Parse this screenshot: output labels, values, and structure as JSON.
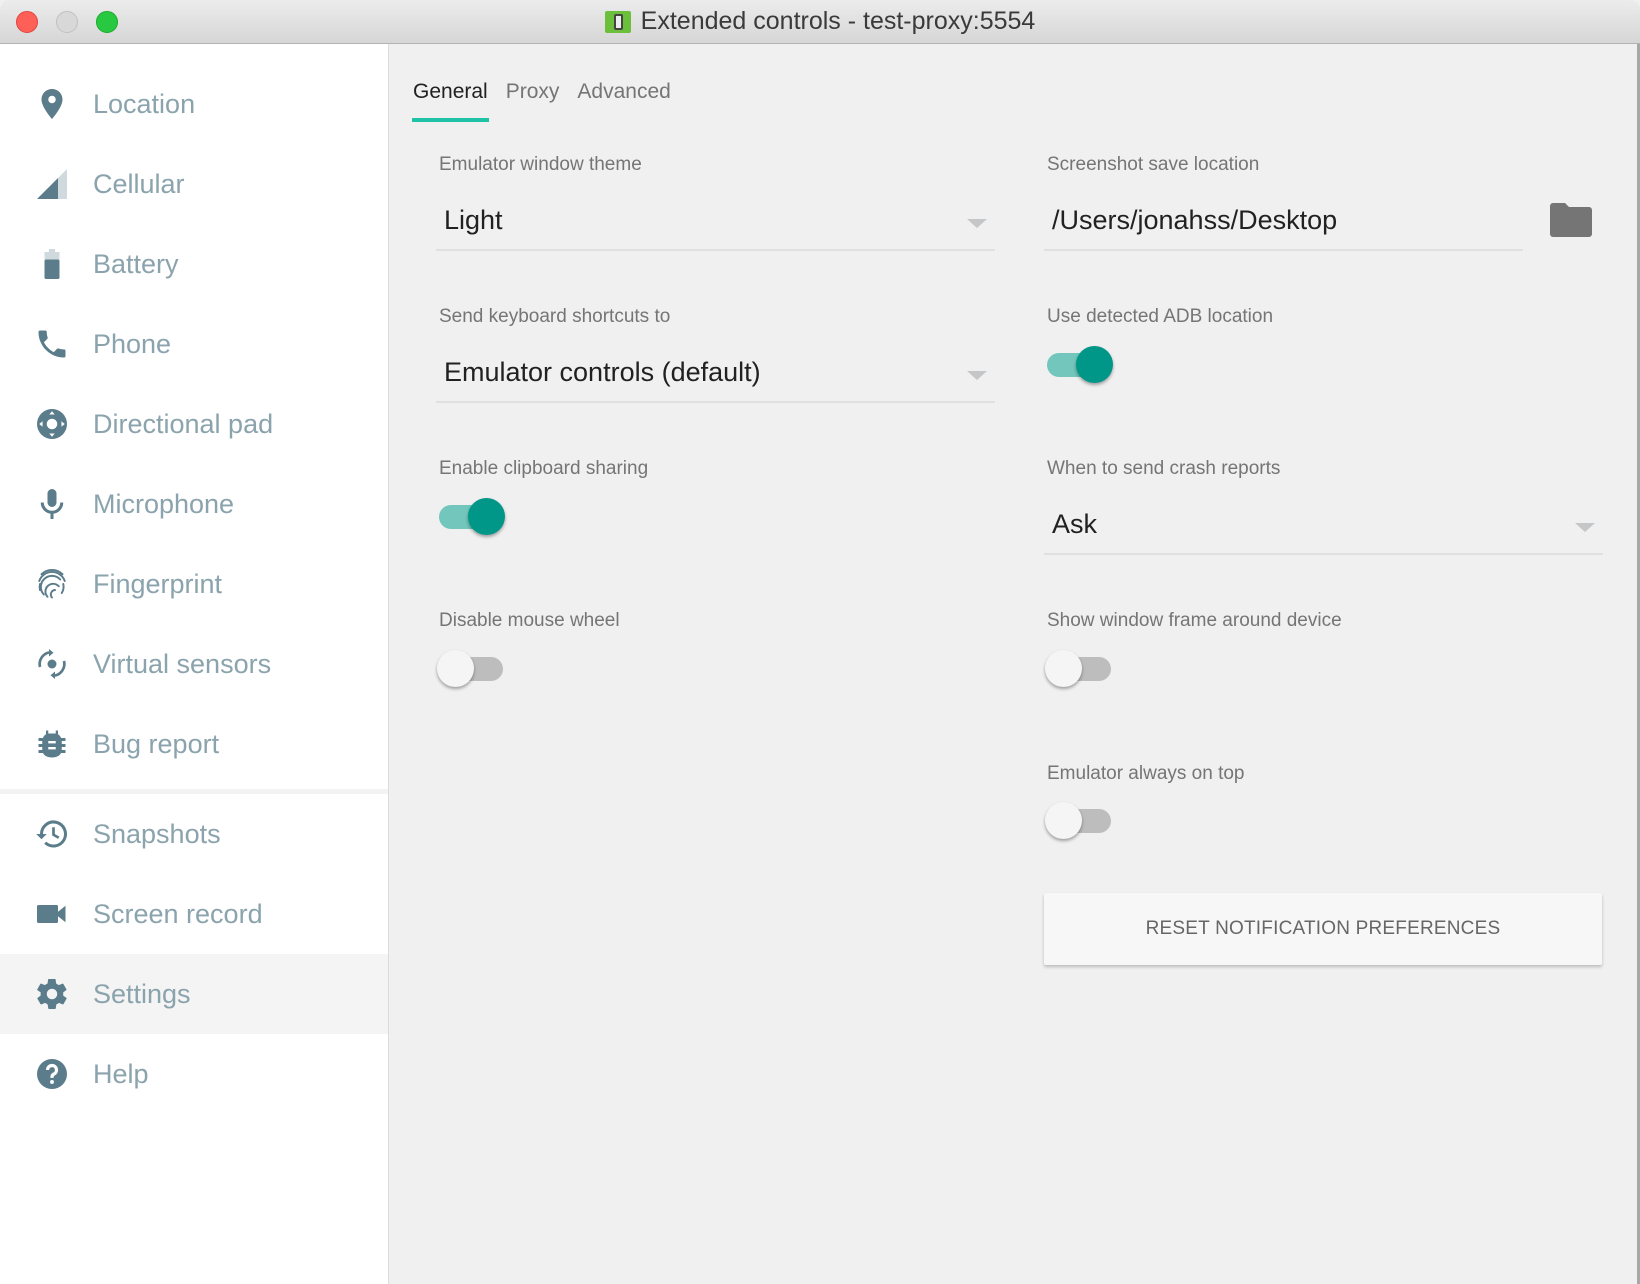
{
  "window": {
    "title": "Extended controls - test-proxy:5554",
    "controls": [
      "close",
      "minimize",
      "maximize"
    ]
  },
  "sidebar": {
    "items": [
      {
        "label": "Location",
        "icon": "location-pin-icon"
      },
      {
        "label": "Cellular",
        "icon": "cellular-signal-icon"
      },
      {
        "label": "Battery",
        "icon": "battery-icon"
      },
      {
        "label": "Phone",
        "icon": "phone-icon"
      },
      {
        "label": "Directional pad",
        "icon": "dpad-icon"
      },
      {
        "label": "Microphone",
        "icon": "microphone-icon"
      },
      {
        "label": "Fingerprint",
        "icon": "fingerprint-icon"
      },
      {
        "label": "Virtual sensors",
        "icon": "virtual-sensors-icon"
      },
      {
        "label": "Bug report",
        "icon": "bug-icon"
      },
      {
        "label": "Snapshots",
        "icon": "history-icon"
      },
      {
        "label": "Screen record",
        "icon": "video-camera-icon"
      },
      {
        "label": "Settings",
        "icon": "gear-icon",
        "active": true
      },
      {
        "label": "Help",
        "icon": "help-icon"
      }
    ]
  },
  "tabs": [
    {
      "label": "General",
      "active": true
    },
    {
      "label": "Proxy",
      "active": false
    },
    {
      "label": "Advanced",
      "active": false
    }
  ],
  "general": {
    "theme": {
      "label": "Emulator window theme",
      "value": "Light"
    },
    "shortcuts": {
      "label": "Send keyboard shortcuts to",
      "value": "Emulator controls (default)"
    },
    "clipboard": {
      "label": "Enable clipboard sharing",
      "on": true
    },
    "mouse_wheel": {
      "label": "Disable mouse wheel",
      "on": false
    },
    "screenshot": {
      "label": "Screenshot save location",
      "value": "/Users/jonahss/Desktop"
    },
    "adb": {
      "label": "Use detected ADB location",
      "on": true
    },
    "crash": {
      "label": "When to send crash reports",
      "value": "Ask"
    },
    "frame": {
      "label": "Show window frame around device",
      "on": false
    },
    "on_top": {
      "label": "Emulator always on top",
      "on": false
    },
    "reset_button": "RESET NOTIFICATION PREFERENCES"
  },
  "colors": {
    "accent": "#1ec3a6",
    "toggle_on_thumb": "#009688",
    "toggle_on_track": "#72c6bb",
    "icon": "#5b7c8a",
    "nav_text": "#8aa3ad"
  }
}
